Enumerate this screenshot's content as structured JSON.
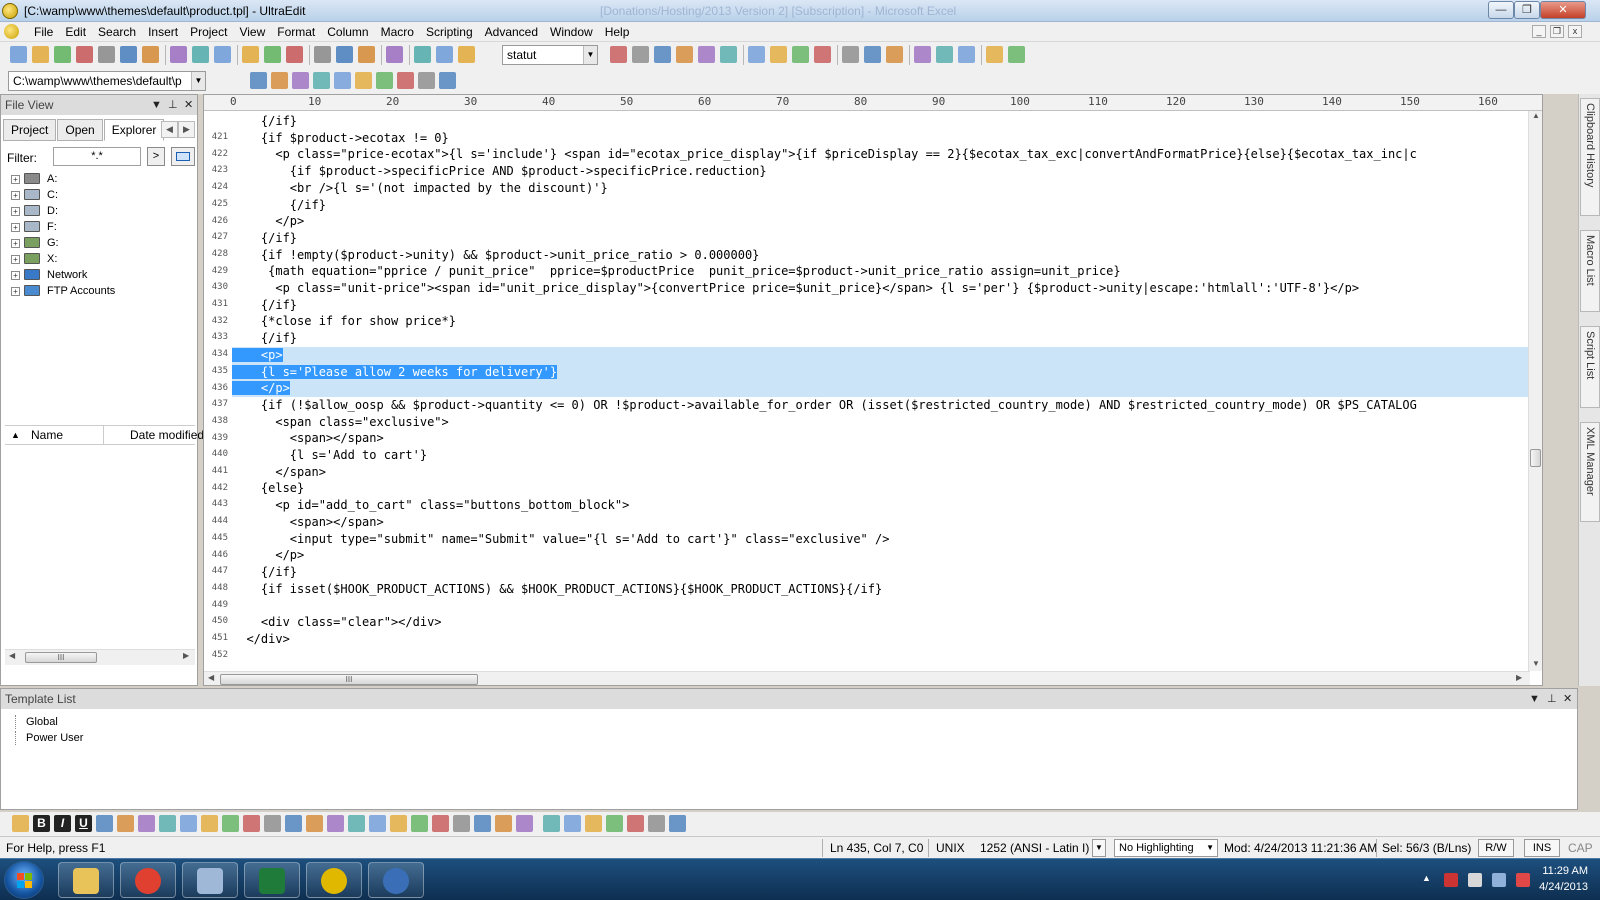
{
  "window": {
    "title": "[C:\\wamp\\www\\themes\\default\\product.tpl] - UltraEdit",
    "ghost_title": "[Donations/Hosting/2013 Version 2] [Subscription] - Microsoft Excel",
    "controls": {
      "minimize": "—",
      "maximize": "❐",
      "close": "✕"
    }
  },
  "menu": {
    "items": [
      {
        "label": "File"
      },
      {
        "label": "Edit"
      },
      {
        "label": "Search"
      },
      {
        "label": "Insert"
      },
      {
        "label": "Project"
      },
      {
        "label": "View"
      },
      {
        "label": "Format"
      },
      {
        "label": "Column"
      },
      {
        "label": "Macro"
      },
      {
        "label": "Scripting"
      },
      {
        "label": "Advanced"
      },
      {
        "label": "Window"
      },
      {
        "label": "Help"
      }
    ]
  },
  "toolbar": {
    "combo_value": "statut",
    "path_combo_value": "C:\\wamp\\www\\themes\\default\\p"
  },
  "file_view": {
    "title": "File View",
    "tabs": [
      {
        "label": "Project"
      },
      {
        "label": "Open"
      },
      {
        "label": "Explorer"
      }
    ],
    "active_tab": "Explorer",
    "filter_label": "Filter:",
    "filter_value": "*.*",
    "go_label": ">",
    "drives": [
      {
        "label": "A:",
        "icon": "floppy-drive-icon"
      },
      {
        "label": "C:",
        "icon": "hard-drive-icon"
      },
      {
        "label": "D:",
        "icon": "hard-drive-icon"
      },
      {
        "label": "F:",
        "icon": "hard-drive-icon"
      },
      {
        "label": "G:",
        "icon": "network-drive-icon"
      },
      {
        "label": "X:",
        "icon": "network-drive-icon"
      },
      {
        "label": "Network",
        "icon": "network-icon"
      },
      {
        "label": "FTP Accounts",
        "icon": "ftp-icon"
      }
    ],
    "list_columns": {
      "name": "Name",
      "date": "Date modified"
    },
    "scroll_glyph": "III"
  },
  "editor": {
    "ruler_marks": [
      "0",
      "10",
      "20",
      "30",
      "40",
      "50",
      "60",
      "70",
      "80",
      "90",
      "100",
      "110",
      "120",
      "130",
      "140",
      "150",
      "160"
    ],
    "lines": [
      {
        "no": "421",
        "text": "    {/if}"
      },
      {
        "no": "422",
        "text": "    {if $product->ecotax != 0}"
      },
      {
        "no": "423",
        "text": "      <p class=\"price-ecotax\">{l s='include'} <span id=\"ecotax_price_display\">{if $priceDisplay == 2}{$ecotax_tax_exc|convertAndFormatPrice}{else}{$ecotax_tax_inc|c"
      },
      {
        "no": "424",
        "text": "        {if $product->specificPrice AND $product->specificPrice.reduction}"
      },
      {
        "no": "425",
        "text": "        <br />{l s='(not impacted by the discount)'}"
      },
      {
        "no": "426",
        "text": "        {/if}"
      },
      {
        "no": "427",
        "text": "      </p>"
      },
      {
        "no": "428",
        "text": "    {/if}"
      },
      {
        "no": "429",
        "text": "    {if !empty($product->unity) && $product->unit_price_ratio > 0.000000}"
      },
      {
        "no": "430",
        "text": "     {math equation=\"pprice / punit_price\"  pprice=$productPrice  punit_price=$product->unit_price_ratio assign=unit_price}"
      },
      {
        "no": "431",
        "text": "      <p class=\"unit-price\"><span id=\"unit_price_display\">{convertPrice price=$unit_price}</span> {l s='per'} {$product->unity|escape:'htmlall':'UTF-8'}</p>"
      },
      {
        "no": "432",
        "text": "    {/if}"
      },
      {
        "no": "433",
        "text": "    {*close if for show price*}"
      },
      {
        "no": "434",
        "text": "    {/if}"
      },
      {
        "no": "435",
        "text": "    <p>",
        "selected": true
      },
      {
        "no": "436",
        "text": "    {l s='Please allow 2 weeks for delivery'}",
        "selected": true
      },
      {
        "no": "437",
        "text": "    </p>",
        "selected": true
      },
      {
        "no": "438",
        "text": "    {if (!$allow_oosp && $product->quantity <= 0) OR !$product->available_for_order OR (isset($restricted_country_mode) AND $restricted_country_mode) OR $PS_CATALOG"
      },
      {
        "no": "439",
        "text": "      <span class=\"exclusive\">"
      },
      {
        "no": "440",
        "text": "        <span></span>"
      },
      {
        "no": "441",
        "text": "        {l s='Add to cart'}"
      },
      {
        "no": "442",
        "text": "      </span>"
      },
      {
        "no": "443",
        "text": "    {else}"
      },
      {
        "no": "444",
        "text": "      <p id=\"add_to_cart\" class=\"buttons_bottom_block\">"
      },
      {
        "no": "445",
        "text": "        <span></span>"
      },
      {
        "no": "446",
        "text": "        <input type=\"submit\" name=\"Submit\" value=\"{l s='Add to cart'}\" class=\"exclusive\" />"
      },
      {
        "no": "447",
        "text": "      </p>"
      },
      {
        "no": "448",
        "text": "    {/if}"
      },
      {
        "no": "449",
        "text": "    {if isset($HOOK_PRODUCT_ACTIONS) && $HOOK_PRODUCT_ACTIONS}{$HOOK_PRODUCT_ACTIONS}{/if}"
      },
      {
        "no": "450",
        "text": ""
      },
      {
        "no": "451",
        "text": "    <div class=\"clear\"></div>"
      },
      {
        "no": "452",
        "text": "  </div>"
      }
    ],
    "scroll_glyph": "III"
  },
  "side_tabs": [
    "Clipboard History",
    "Macro List",
    "Script List",
    "XML Manager"
  ],
  "template_list": {
    "title": "Template List",
    "items": [
      "Global",
      "Power User"
    ]
  },
  "status": {
    "help": "For Help, press F1",
    "position": "Ln 435, Col 7, C0",
    "line_ending": "UNIX",
    "encoding": "1252  (ANSI - Latin I)",
    "highlighting": "No Highlighting",
    "modified": "Mod: 4/24/2013 11:21:36 AM",
    "selection": "Sel: 56/3 (B/Lns)",
    "rw": "R/W",
    "ins": "INS",
    "cap": "CAP"
  },
  "taskbar": {
    "apps": [
      {
        "name": "explorer",
        "icon": "folder-icon",
        "color": "#e8c35a"
      },
      {
        "name": "chrome",
        "icon": "chrome-icon",
        "color": "#e04030"
      },
      {
        "name": "calculator",
        "icon": "calculator-icon",
        "color": "#9fb8d8"
      },
      {
        "name": "excel",
        "icon": "excel-icon",
        "color": "#1e7b3a"
      },
      {
        "name": "ultraedit",
        "icon": "ultraedit-icon",
        "color": "#e0b800"
      },
      {
        "name": "thunderbird",
        "icon": "thunderbird-icon",
        "color": "#3a6fb8"
      }
    ],
    "clock_time": "11:29 AM",
    "clock_date": "4/24/2013"
  },
  "colors": {
    "selection": "#3399ff",
    "selection_band": "#cce4f7",
    "taskbar": "#163f68"
  }
}
